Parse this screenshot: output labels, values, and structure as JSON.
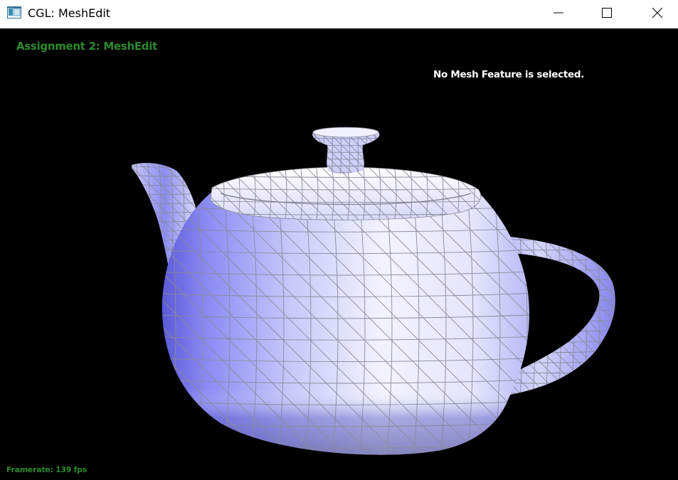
{
  "window": {
    "title": "CGL: MeshEdit"
  },
  "viewport": {
    "heading": "Assignment 2: MeshEdit",
    "status": "No Mesh Feature is selected.",
    "framerate": "Framerate: 139 fps"
  },
  "colors": {
    "heading": "#2e8b2e",
    "status": "#ffffff",
    "background": "#000000",
    "mesh_fill_light": "#f2f2ff",
    "mesh_fill_dark": "#7b7bf0",
    "mesh_wire": "#8a8a9a"
  },
  "icons": {
    "app": "app-window-icon",
    "minimize": "minimize-icon",
    "maximize": "maximize-icon",
    "close": "close-icon"
  }
}
